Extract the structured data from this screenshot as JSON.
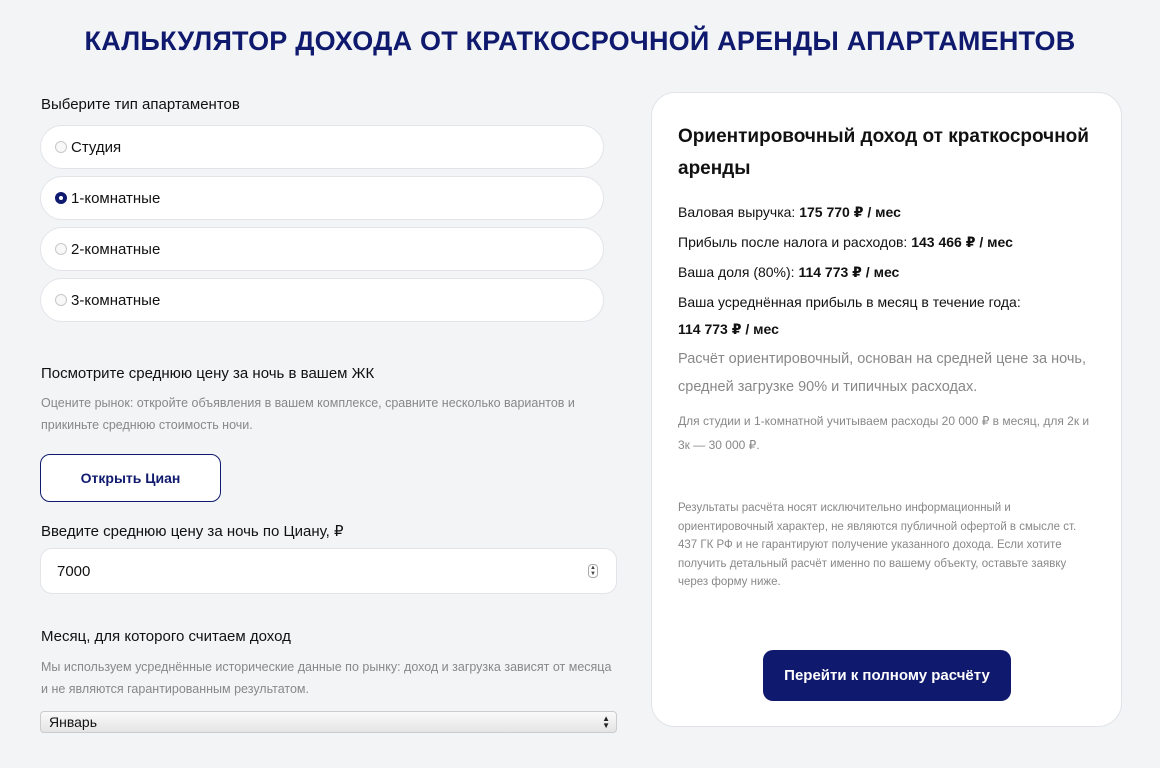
{
  "header": {
    "title": "КАЛЬКУЛЯТОР ДОХОДА ОТ КРАТКОСРОЧНОЙ АРЕНДЫ АПАРТАМЕНТОВ"
  },
  "apartment_type": {
    "label": "Выберите тип апартаментов",
    "options": [
      {
        "label": "Студия",
        "checked": false
      },
      {
        "label": "1-комнатные",
        "checked": true
      },
      {
        "label": "2-комнатные",
        "checked": false
      },
      {
        "label": "3-комнатные",
        "checked": false
      }
    ]
  },
  "avg_price": {
    "label": "Посмотрите среднюю цену за ночь в вашем ЖК",
    "hint": "Оцените рынок: откройте объявления в вашем комплексе, сравните несколько вариантов и прикиньте среднюю стоимость ночи.",
    "cian_button": "Открыть Циан"
  },
  "price_input": {
    "label": "Введите среднюю цену за ночь по Циану, ₽",
    "value": "7000"
  },
  "month": {
    "label": "Месяц, для которого считаем доход",
    "hint": "Мы используем усреднённые исторические данные по рынку: доход и загрузка зависят от месяца и не являются гарантированным результатом.",
    "selected": "Январь"
  },
  "result": {
    "title": "Ориентировочный доход от краткосрочной аренды",
    "gross_label": "Валовая выручка: ",
    "gross_value": "175 770 ₽ / мес",
    "profit_label": "Прибыль после налога и расходов: ",
    "profit_value": "143 466 ₽ / мес",
    "share_label": "Ваша доля (80%): ",
    "share_value": "114 773 ₽ / мес",
    "avg_label": "Ваша усреднённая прибыль в месяц в течение года:",
    "avg_value": "114 773 ₽ / мес",
    "note": "Расчёт ориентировочный, основан на средней цене за ночь, средней загрузке 90% и типичных расходах.",
    "expenses_note": "Для студии и 1-комнатной учитываем расходы 20 000 ₽ в месяц, для 2к и 3к — 30 000 ₽.",
    "disclaimer": "Результаты расчёта носят исключительно информационный и ориентировочный характер, не являются публичной офертой в смысле ст. 437 ГК РФ и не гарантируют получение указанного дохода. Если хотите получить детальный расчёт именно по вашему объекту, оставьте заявку через форму ниже.",
    "full_calc_button": "Перейти к полному расчёту"
  },
  "colors": {
    "accent": "#0f1a6e",
    "background": "#f3f4f6",
    "muted_text": "#888888"
  }
}
